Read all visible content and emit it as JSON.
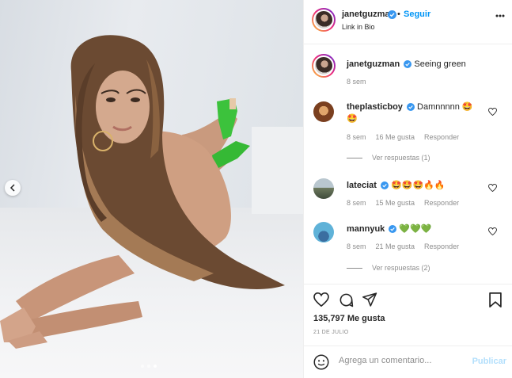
{
  "post": {
    "carousel": {
      "slides": 3,
      "active_slide": 3
    }
  },
  "header": {
    "username": "janetguzman",
    "separator": "•",
    "follow_label": "Seguir",
    "subline": "Link in Bio"
  },
  "caption": {
    "username": "janetguzman",
    "text": "Seeing green",
    "time": "8 sem"
  },
  "comments": [
    {
      "username": "theplasticboy",
      "text": "Damnnnnn 🤩🤩",
      "time": "8 sem",
      "likes": "16 Me gusta",
      "reply_label": "Responder",
      "replies_label": "Ver respuestas (1)"
    },
    {
      "username": "lateciat",
      "text": "🤩🤩🤩🔥🔥",
      "time": "8 sem",
      "likes": "15 Me gusta",
      "reply_label": "Responder"
    },
    {
      "username": "mannyuk",
      "text": "💚💚💚",
      "time": "8 sem",
      "likes": "21 Me gusta",
      "reply_label": "Responder",
      "replies_label": "Ver respuestas (2)"
    }
  ],
  "actions": {
    "likes": "135,797 Me gusta",
    "date": "21 DE JULIO"
  },
  "composer": {
    "placeholder": "Agrega un comentario...",
    "publish_label": "Publicar"
  },
  "colors": {
    "accent": "#0095f6",
    "verified": "#3897f0",
    "publish_disabled": "#b2dffc",
    "muted": "#8e8e8e"
  },
  "icons": [
    "verified-badge-icon",
    "more-options-icon",
    "heart-icon",
    "comment-icon",
    "share-icon",
    "bookmark-icon",
    "emoji-icon",
    "chevron-left-icon"
  ]
}
